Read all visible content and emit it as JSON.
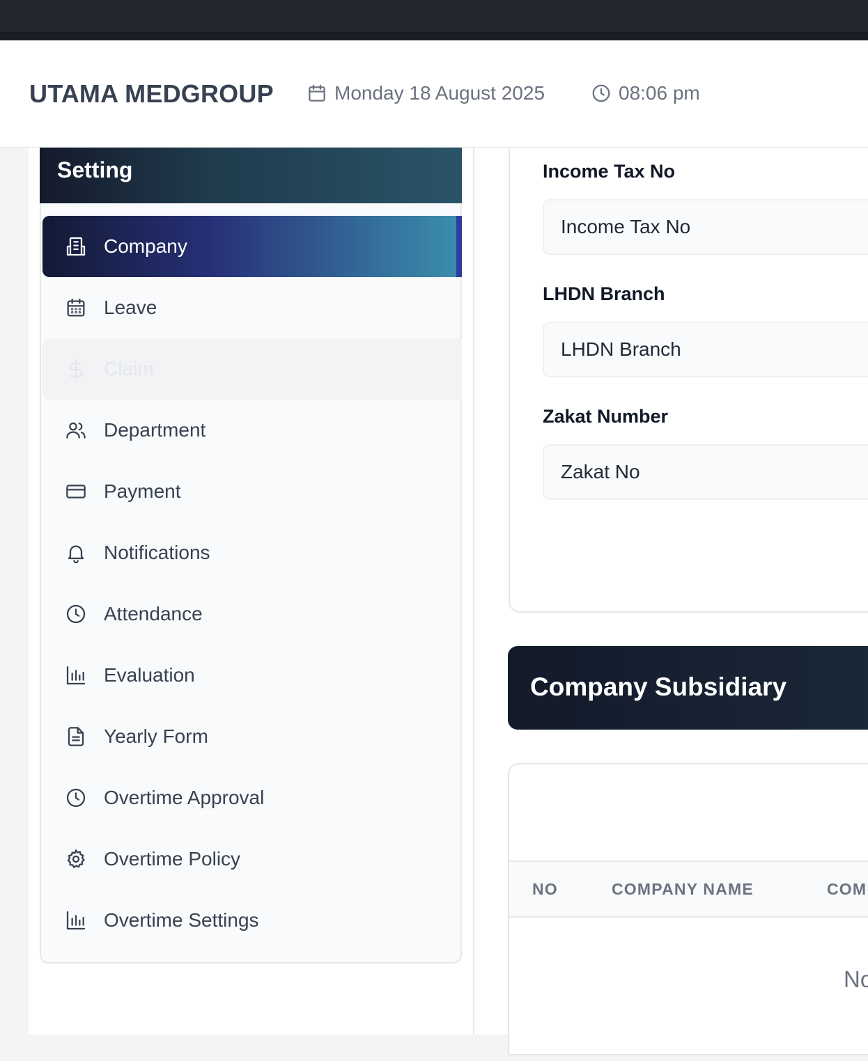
{
  "header": {
    "brand": "UTAMA MEDGROUP",
    "date": "Monday 18 August 2025",
    "time": "08:06 pm"
  },
  "sidebar": {
    "title": "Setting",
    "items": [
      {
        "label": "Company",
        "icon": "building-icon",
        "state": "active"
      },
      {
        "label": "Leave",
        "icon": "calendar-icon",
        "state": "normal"
      },
      {
        "label": "Claim",
        "icon": "dollar-icon",
        "state": "disabled"
      },
      {
        "label": "Department",
        "icon": "users-icon",
        "state": "normal"
      },
      {
        "label": "Payment",
        "icon": "credit-card-icon",
        "state": "normal"
      },
      {
        "label": "Notifications",
        "icon": "bell-icon",
        "state": "normal"
      },
      {
        "label": "Attendance",
        "icon": "clock-icon",
        "state": "normal"
      },
      {
        "label": "Evaluation",
        "icon": "bar-chart-icon",
        "state": "normal"
      },
      {
        "label": "Yearly Form",
        "icon": "document-icon",
        "state": "normal"
      },
      {
        "label": "Overtime Approval",
        "icon": "clock-icon",
        "state": "normal"
      },
      {
        "label": "Overtime Policy",
        "icon": "gear-icon",
        "state": "normal"
      },
      {
        "label": "Overtime Settings",
        "icon": "bar-chart-icon",
        "state": "normal"
      }
    ]
  },
  "form": {
    "income_tax": {
      "label": "Income Tax No",
      "placeholder": "Income Tax No"
    },
    "lhdn_branch": {
      "label": "LHDN Branch",
      "placeholder": "LHDN Branch"
    },
    "zakat": {
      "label": "Zakat Number",
      "placeholder": "Zakat No"
    }
  },
  "subsidiary": {
    "title": "Company Subsidiary",
    "columns": [
      "NO",
      "COMPANY NAME",
      "COM"
    ],
    "empty_text": "No"
  },
  "colors": {
    "active_gradient_start": "#121a34",
    "active_gradient_end": "#3b8fad",
    "header_dark": "#131a2a"
  }
}
